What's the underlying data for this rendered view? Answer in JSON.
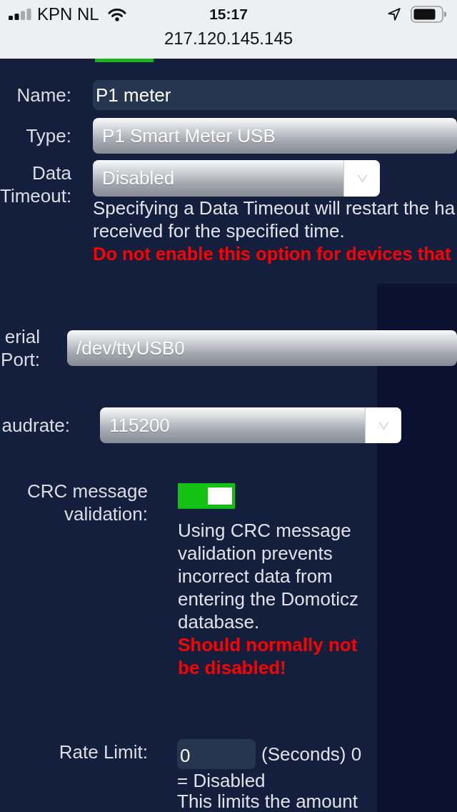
{
  "status_bar": {
    "carrier": "KPN NL",
    "time": "15:17",
    "url": "217.120.145.145"
  },
  "sections": [
    {
      "rows": [
        {
          "kind": "text",
          "label": "Name:",
          "value": "P1 meter"
        },
        {
          "kind": "select",
          "label": "Type:",
          "value": "P1 Smart Meter USB"
        },
        {
          "kind": "select",
          "label": "Data Timeout:",
          "value": "Disabled",
          "help": [
            "Specifying a Data Timeout will restart the ha",
            "received for the specified time."
          ],
          "warning": "Do not enable this option for devices that"
        }
      ]
    },
    {
      "rows": [
        {
          "kind": "select",
          "label": "erial Port:",
          "value": "/dev/ttyUSB0"
        }
      ]
    },
    {
      "rows": [
        {
          "kind": "select",
          "label": "audrate:",
          "value": "115200"
        }
      ]
    },
    {
      "rows": [
        {
          "kind": "toggle",
          "label": "CRC message validation:",
          "on": true,
          "help": [
            "Using CRC message validation prevents incorrect data from entering the Domoticz database."
          ],
          "warning": "Should normally not be disabled!"
        }
      ]
    },
    {
      "rows": [
        {
          "kind": "number",
          "label": "Rate Limit:",
          "value": "0",
          "unit": [
            "(Seconds) 0",
            "= Disabled"
          ],
          "help": [
            "This limits the amount"
          ]
        }
      ]
    }
  ]
}
